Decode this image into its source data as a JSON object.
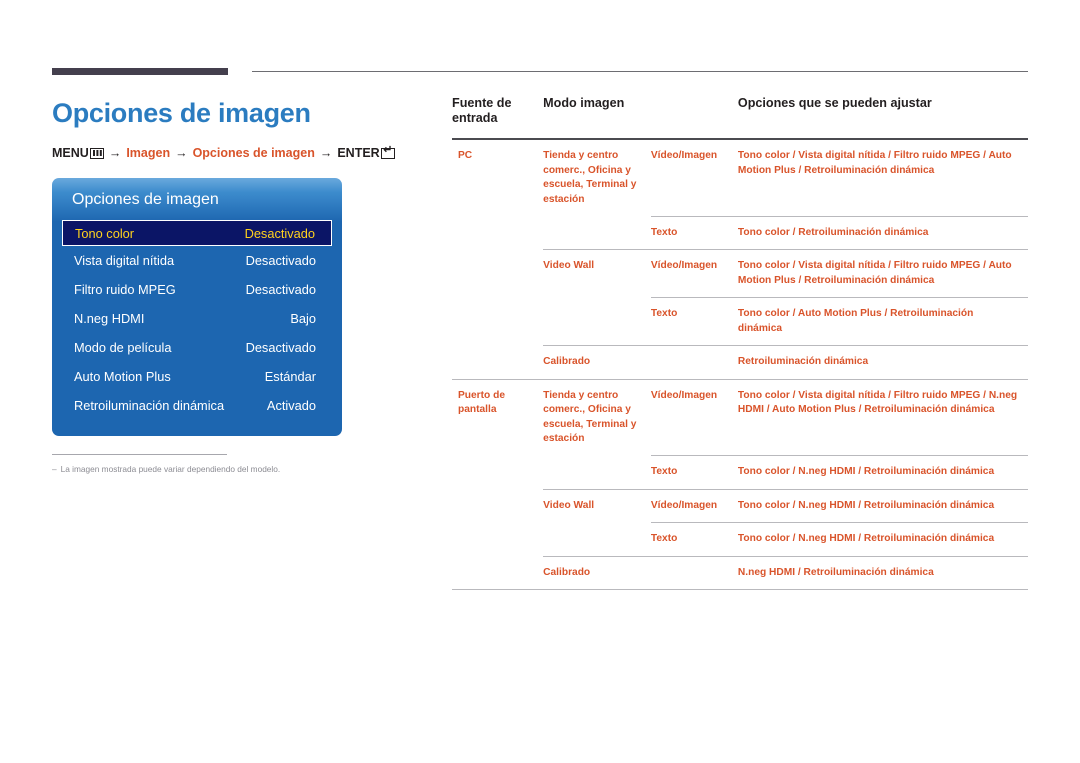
{
  "page": {
    "title": "Opciones de imagen",
    "title_color": "#2b7cc0",
    "accent_color": "#d9542b"
  },
  "breadcrumb": {
    "menu_label": "MENU",
    "menu_icon": "menu-bars-icon",
    "arrow": "→",
    "step1": "Imagen",
    "step2": "Opciones de imagen",
    "enter_label": "ENTER",
    "enter_icon": "enter-return-icon"
  },
  "osd": {
    "title": "Opciones de imagen",
    "rows": [
      {
        "label": "Tono color",
        "value": "Desactivado",
        "selected": true
      },
      {
        "label": "Vista digital nítida",
        "value": "Desactivado",
        "selected": false
      },
      {
        "label": "Filtro ruido MPEG",
        "value": "Desactivado",
        "selected": false
      },
      {
        "label": "N.neg HDMI",
        "value": "Bajo",
        "selected": false
      },
      {
        "label": "Modo de película",
        "value": "Desactivado",
        "selected": false
      },
      {
        "label": "Auto Motion Plus",
        "value": "Estándar",
        "selected": false
      },
      {
        "label": "Retroiluminación dinámica",
        "value": "Activado",
        "selected": false
      }
    ]
  },
  "footnote": {
    "dash": "–",
    "text": "La imagen mostrada puede variar dependiendo del modelo."
  },
  "table": {
    "headers": {
      "source": "Fuente de entrada",
      "mode": "Modo imagen",
      "sub": "",
      "options": "Opciones que se pueden ajustar"
    },
    "rows": [
      {
        "source": "PC",
        "mode": "Tienda y centro comerc., Oficina y escuela, Terminal y estación",
        "sub": "Vídeo/Imagen",
        "options": "Tono color / Vista digital nítida / Filtro ruido MPEG / Auto Motion Plus / Retroiluminación dinámica"
      },
      {
        "source": "",
        "mode": "",
        "sub": "Texto",
        "options": "Tono color / Retroiluminación dinámica"
      },
      {
        "source": "",
        "mode": "Video Wall",
        "sub": "Vídeo/Imagen",
        "options": "Tono color / Vista digital nítida / Filtro ruido MPEG / Auto Motion Plus / Retroiluminación dinámica"
      },
      {
        "source": "",
        "mode": "",
        "sub": "Texto",
        "options": "Tono color / Auto Motion Plus / Retroiluminación dinámica"
      },
      {
        "source": "",
        "mode": "Calibrado",
        "sub": "",
        "options": "Retroiluminación dinámica"
      },
      {
        "source": "Puerto de pantalla",
        "mode": "Tienda y centro comerc., Oficina y escuela, Terminal y estación",
        "sub": "Vídeo/Imagen",
        "options": "Tono color / Vista digital nítida / Filtro ruido MPEG / N.neg HDMI / Auto Motion Plus / Retroiluminación dinámica"
      },
      {
        "source": "",
        "mode": "",
        "sub": "Texto",
        "options": "Tono color / N.neg HDMI / Retroiluminación dinámica"
      },
      {
        "source": "",
        "mode": "Video Wall",
        "sub": "Vídeo/Imagen",
        "options": "Tono color / N.neg HDMI / Retroiluminación dinámica"
      },
      {
        "source": "",
        "mode": "",
        "sub": "Texto",
        "options": "Tono color / N.neg HDMI / Retroiluminación dinámica"
      },
      {
        "source": "",
        "mode": "Calibrado",
        "sub": "",
        "options": "N.neg HDMI / Retroiluminación dinámica"
      }
    ]
  }
}
